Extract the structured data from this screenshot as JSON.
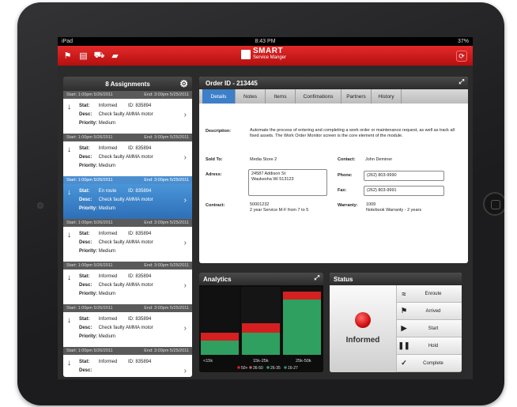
{
  "device": {
    "carrier": "iPad",
    "time": "8:43 PM",
    "battery": "37%"
  },
  "app": {
    "logo_big": "SMART",
    "logo_small": "Service Manger"
  },
  "assignments": {
    "header": "8 Assignments",
    "items": [
      {
        "start": "Start: 1:00pm 5/26/2011",
        "end": "End: 3:00pm 5/25/2011",
        "stat": "Informed",
        "id": "ID: 835894",
        "desc": "Check faulty AMMA motor",
        "priority": "Medium"
      },
      {
        "start": "Start: 1:00pm 5/26/2011",
        "end": "End: 3:00pm 5/25/2011",
        "stat": "Informed",
        "id": "ID: 835894",
        "desc": "Check faulty AMMA motor",
        "priority": "Medium"
      },
      {
        "start": "Start: 1:00pm 5/26/2011",
        "end": "End: 3:00pm 5/25/2011",
        "stat": "En route",
        "id": "ID: 835894",
        "desc": "Check faulty AMMA motor",
        "priority": "Medium"
      },
      {
        "start": "Start: 1:00pm 5/26/2011",
        "end": "End: 3:00pm 5/25/2011",
        "stat": "Informed",
        "id": "ID: 835894",
        "desc": "Check faulty AMMA motor",
        "priority": "Medium"
      },
      {
        "start": "Start: 1:00pm 5/26/2011",
        "end": "End: 3:00pm 5/25/2011",
        "stat": "Informed",
        "id": "ID: 835894",
        "desc": "Check faulty AMMA motor",
        "priority": "Medium"
      },
      {
        "start": "Start: 1:00pm 5/26/2011",
        "end": "End: 3:00pm 5/25/2011",
        "stat": "Informed",
        "id": "ID: 835894",
        "desc": "Check faulty AMMA motor",
        "priority": "Medium"
      },
      {
        "start": "Start: 1:00pm 5/26/2011",
        "end": "End: 3:00pm 5/25/2011",
        "stat": "Informed",
        "id": "ID: 835894",
        "desc": "",
        "priority": ""
      }
    ],
    "labels": {
      "stat": "Stat:",
      "desc": "Desc:",
      "priority": "Priority:"
    }
  },
  "order": {
    "title": "Order ID - 213445",
    "tabs": [
      "Details",
      "Notes",
      "Items",
      "Confimations",
      "Partners",
      "History"
    ],
    "description_label": "Description:",
    "description": "Automate the process of entering and completing a work order or maintenance request, as well as track all fixed assets.  The Work Order Monitor screen is the core element of the module.",
    "sold_to_label": "Sold To:",
    "sold_to": "Media Store 2",
    "contact_label": "Contact:",
    "contact": "John Deminer",
    "address_label": "Adress:",
    "address_line1": "24587 Addison St",
    "address_line2": "Waukesha Wi 513123",
    "phone_label": "Phone:",
    "phone": "(262) 803-9990",
    "fax_label": "Fax:",
    "fax": "(262) 803-9991",
    "contract_label": "Contract:",
    "contract_line1": "50001232",
    "contract_line2": "2 year Service M-F from 7 to 5",
    "warranty_label": "Warranty:",
    "warranty_line1": "1009",
    "warranty_line2": "Notebook Warranty - 2 years"
  },
  "analytics": {
    "title": "Analytics"
  },
  "chart_data": {
    "type": "bar",
    "categories": [
      "<15k",
      "15k-25k",
      "25k-50k"
    ],
    "series": [
      {
        "name": "50+",
        "color": "#d42020",
        "values": [
          10,
          12,
          10
        ]
      },
      {
        "name": "36-50",
        "color": "#c06060",
        "values": [
          0,
          0,
          0
        ]
      },
      {
        "name": "26-35",
        "color": "#2fa060",
        "values": [
          18,
          28,
          70
        ]
      },
      {
        "name": "16-27",
        "color": "#3a8a70",
        "values": [
          0,
          0,
          0
        ]
      }
    ],
    "legend": [
      "50+",
      "36-50",
      "26-35",
      "16-27"
    ]
  },
  "status": {
    "title": "Status",
    "current": "Informed",
    "buttons": [
      {
        "label": "Enroute",
        "icon": "≈"
      },
      {
        "label": "Arrived",
        "icon": "⚑"
      },
      {
        "label": "Start",
        "icon": "▶"
      },
      {
        "label": "Hold",
        "icon": "❚❚"
      },
      {
        "label": "Complete",
        "icon": "✓"
      }
    ]
  }
}
